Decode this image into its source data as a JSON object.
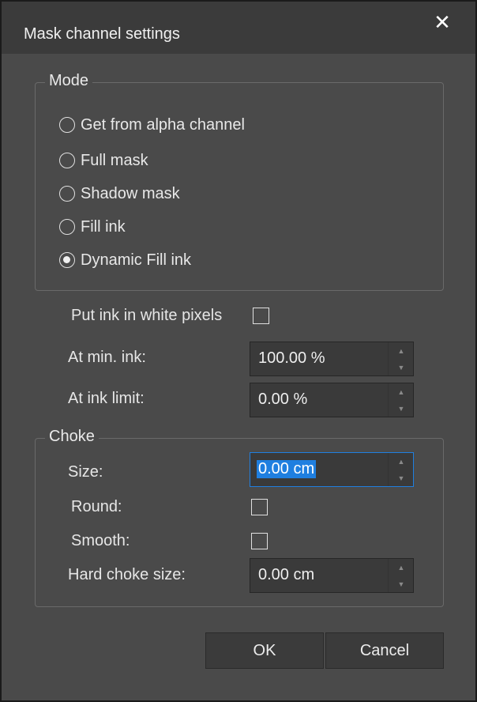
{
  "dialog": {
    "title": "Mask channel settings",
    "close_icon": "close-icon"
  },
  "mode": {
    "title": "Mode",
    "options": [
      {
        "label": "Get from alpha channel",
        "checked": false
      },
      {
        "label": "Full mask",
        "checked": false
      },
      {
        "label": "Shadow mask",
        "checked": false
      },
      {
        "label": "Fill ink",
        "checked": false
      },
      {
        "label": "Dynamic Fill ink",
        "checked": true
      }
    ]
  },
  "ink": {
    "white_pixels_label": "Put ink in white pixels",
    "white_pixels_checked": false,
    "min_ink_label": "At min. ink:",
    "min_ink_value": "100.00 %",
    "ink_limit_label": "At ink limit:",
    "ink_limit_value": "0.00 %"
  },
  "choke": {
    "title": "Choke",
    "size_label": "Size:",
    "size_value": "0.00 cm",
    "round_label": "Round:",
    "round_checked": false,
    "smooth_label": "Smooth:",
    "smooth_checked": false,
    "hard_label": "Hard choke size:",
    "hard_value": "0.00 cm"
  },
  "buttons": {
    "ok": "OK",
    "cancel": "Cancel"
  },
  "colors": {
    "dialog_bg": "#4a4a4a",
    "titlebar_bg": "#3b3b3b",
    "accent": "#1f7fe0"
  }
}
